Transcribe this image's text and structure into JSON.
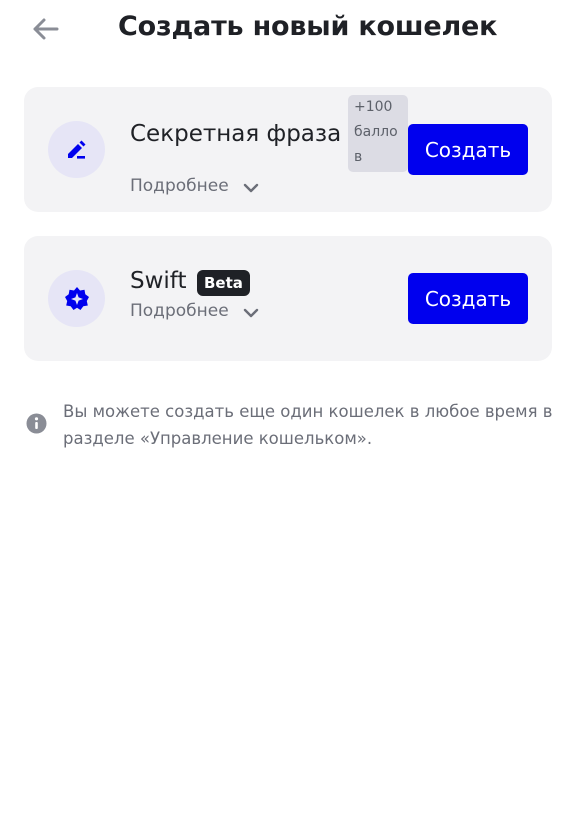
{
  "header": {
    "title": "Создать новый кошелек",
    "back_icon": "arrow-left-icon"
  },
  "cards": [
    {
      "icon": "edit-pen-icon",
      "title": "Секретная фраза",
      "badge_lines": [
        "+100",
        "балло",
        "в"
      ],
      "details_label": "Подробнее",
      "create_label": "Создать"
    },
    {
      "icon": "badge-star-icon",
      "title": "Swift",
      "beta_label": "Beta",
      "details_label": "Подробнее",
      "create_label": "Создать"
    }
  ],
  "info": {
    "icon": "info-icon",
    "text": "Вы можете создать еще один кошелек в любое время в разделе «Управление кошельком»."
  },
  "colors": {
    "accent": "#0000EE",
    "card_bg": "#F3F3F5",
    "icon_bg": "#E6E5F6",
    "text_secondary": "#6B6E78"
  }
}
